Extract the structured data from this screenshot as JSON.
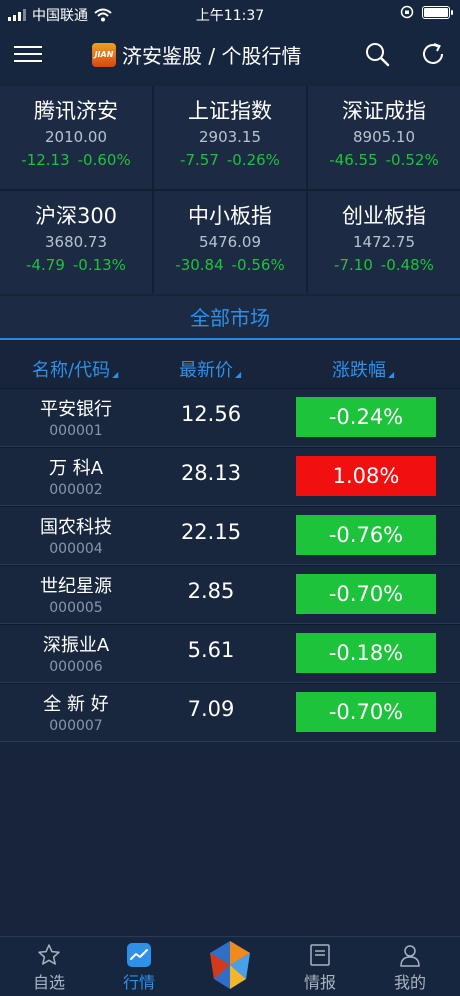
{
  "status_bar": {
    "carrier": "中国联通",
    "time": "上午11:37"
  },
  "nav": {
    "logo_text": "JIAN",
    "title": "济安鉴股 / 个股行情"
  },
  "indices": [
    {
      "name": "腾讯济安",
      "value": "2010.00",
      "change": "-12.13",
      "percent": "-0.60%"
    },
    {
      "name": "上证指数",
      "value": "2903.15",
      "change": "-7.57",
      "percent": "-0.26%"
    },
    {
      "name": "深证成指",
      "value": "8905.10",
      "change": "-46.55",
      "percent": "-0.52%"
    },
    {
      "name": "沪深300",
      "value": "3680.73",
      "change": "-4.79",
      "percent": "-0.13%"
    },
    {
      "name": "中小板指",
      "value": "5476.09",
      "change": "-30.84",
      "percent": "-0.56%"
    },
    {
      "name": "创业板指",
      "value": "1472.75",
      "change": "-7.10",
      "percent": "-0.48%"
    }
  ],
  "section_title": "全部市场",
  "table": {
    "headers": {
      "name_code": "名称/代码",
      "price": "最新价",
      "change_pct": "涨跌幅"
    },
    "rows": [
      {
        "name": "平安银行",
        "code": "000001",
        "price": "12.56",
        "pct": "-0.24%",
        "direction": "down"
      },
      {
        "name": "万 科A",
        "code": "000002",
        "price": "28.13",
        "pct": "1.08%",
        "direction": "up"
      },
      {
        "name": "国农科技",
        "code": "000004",
        "price": "22.15",
        "pct": "-0.76%",
        "direction": "down"
      },
      {
        "name": "世纪星源",
        "code": "000005",
        "price": "2.85",
        "pct": "-0.70%",
        "direction": "down"
      },
      {
        "name": "深振业A",
        "code": "000006",
        "price": "5.61",
        "pct": "-0.18%",
        "direction": "down"
      },
      {
        "name": "全 新 好",
        "code": "000007",
        "price": "7.09",
        "pct": "-0.70%",
        "direction": "down"
      }
    ]
  },
  "tabbar": {
    "watchlist": "自选",
    "market": "行情",
    "news": "情报",
    "mine": "我的"
  },
  "colors": {
    "accent": "#2f90e8",
    "down": "#1ec33c",
    "up": "#f20f0f",
    "background": "#17243a"
  }
}
